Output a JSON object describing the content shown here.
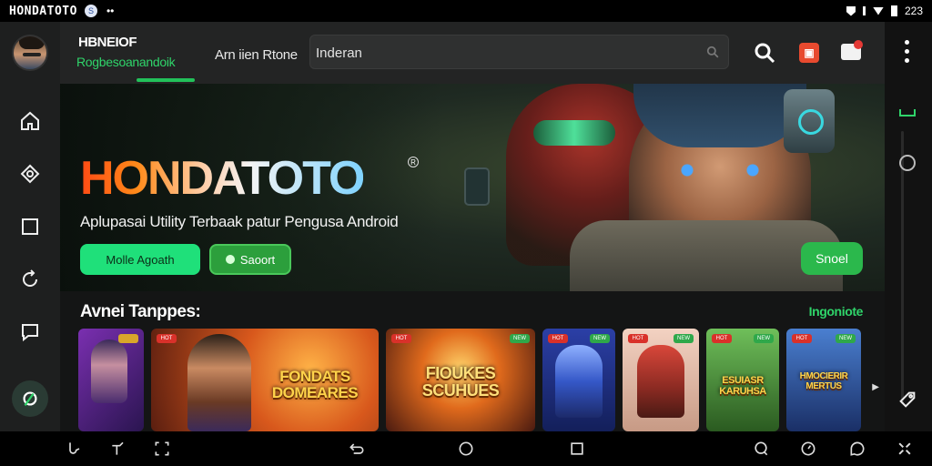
{
  "status_bar": {
    "title": "HONDATOTO",
    "badge": "S",
    "dots": "••",
    "time": "223"
  },
  "app_bar": {
    "app_name": "HBNEIOF",
    "app_subtitle": "Rogbesoanandoik",
    "tab_label": "Arn iien Rtone",
    "search_value": "Inderan"
  },
  "hero": {
    "title": "HONDATOTO",
    "registered": "R",
    "subtitle": "Aplupasai Utility Terbaak patur Pengusa Android",
    "primary_button": "Molle Agoath",
    "secondary_button": "Saoort",
    "right_button": "Snoel"
  },
  "section": {
    "title": "Avnei Tanppes:",
    "link": "Ingoniote",
    "cards": [
      {
        "title": "",
        "badge_l": "",
        "badge_r": "",
        "bg": "#5a2c86"
      },
      {
        "title": "FONDATS\nDOMEARES",
        "badge_l": "HOT",
        "badge_r": "",
        "bg": "#c4541b"
      },
      {
        "title": "FIOUKES\nSCUHUES",
        "badge_l": "HOT",
        "badge_r": "NEW",
        "bg": "#b0431e"
      },
      {
        "title": "",
        "badge_l": "HOT",
        "badge_r": "NEW",
        "bg": "#2a3d9a"
      },
      {
        "title": "",
        "badge_l": "HOT",
        "badge_r": "NEW",
        "bg": "#d9b3a2"
      },
      {
        "title": "ESUIASR\nKARUHSA",
        "badge_l": "HOT",
        "badge_r": "NEW",
        "bg": "#3f8a3a"
      },
      {
        "title": "HMOCIERIR\nMERTUS",
        "badge_l": "HOT",
        "badge_r": "NEW",
        "bg": "#355fae"
      }
    ]
  },
  "colors": {
    "accent": "#22c15a",
    "hero_orange": "#ff4a14",
    "background": "#1e1f1f"
  }
}
